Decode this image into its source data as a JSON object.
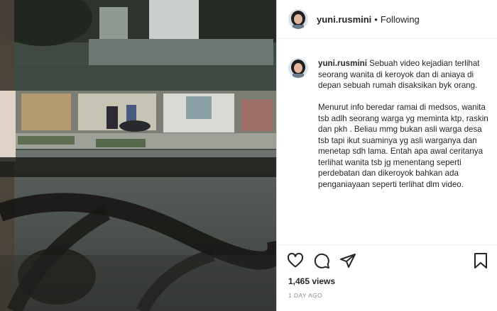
{
  "post": {
    "username": "yuni.rusmini",
    "separator": "•",
    "follow_status": "Following",
    "caption_paragraph_1": "Sebuah video kejadian terlihat seorang wanita di keroyok dan di aniaya di depan sebuah rumah disaksikan byk orang.",
    "caption_paragraph_2": "Menurut info beredar ramai di medsos, wanita tsb adlh seorang warga yg meminta ktp, raskin dan pkh . Beliau mmg bukan asli warga desa tsb tapi ikut suaminya yg asli warganya dan menetap sdh lama. Entah apa awal ceritanya terlihat wanita tsb jg menentang seperti perdebatan dan dikeroyok bahkan ada penganiayaan seperti terlihat dlm video.",
    "views": "1,465 views",
    "timestamp": "1 DAY AGO"
  },
  "icons": {
    "like": "heart-icon",
    "comment": "comment-icon",
    "share": "send-icon",
    "save": "bookmark-icon"
  },
  "colors": {
    "text": "#262626",
    "muted": "#8e8e8e",
    "border": "#dbdbdb"
  }
}
